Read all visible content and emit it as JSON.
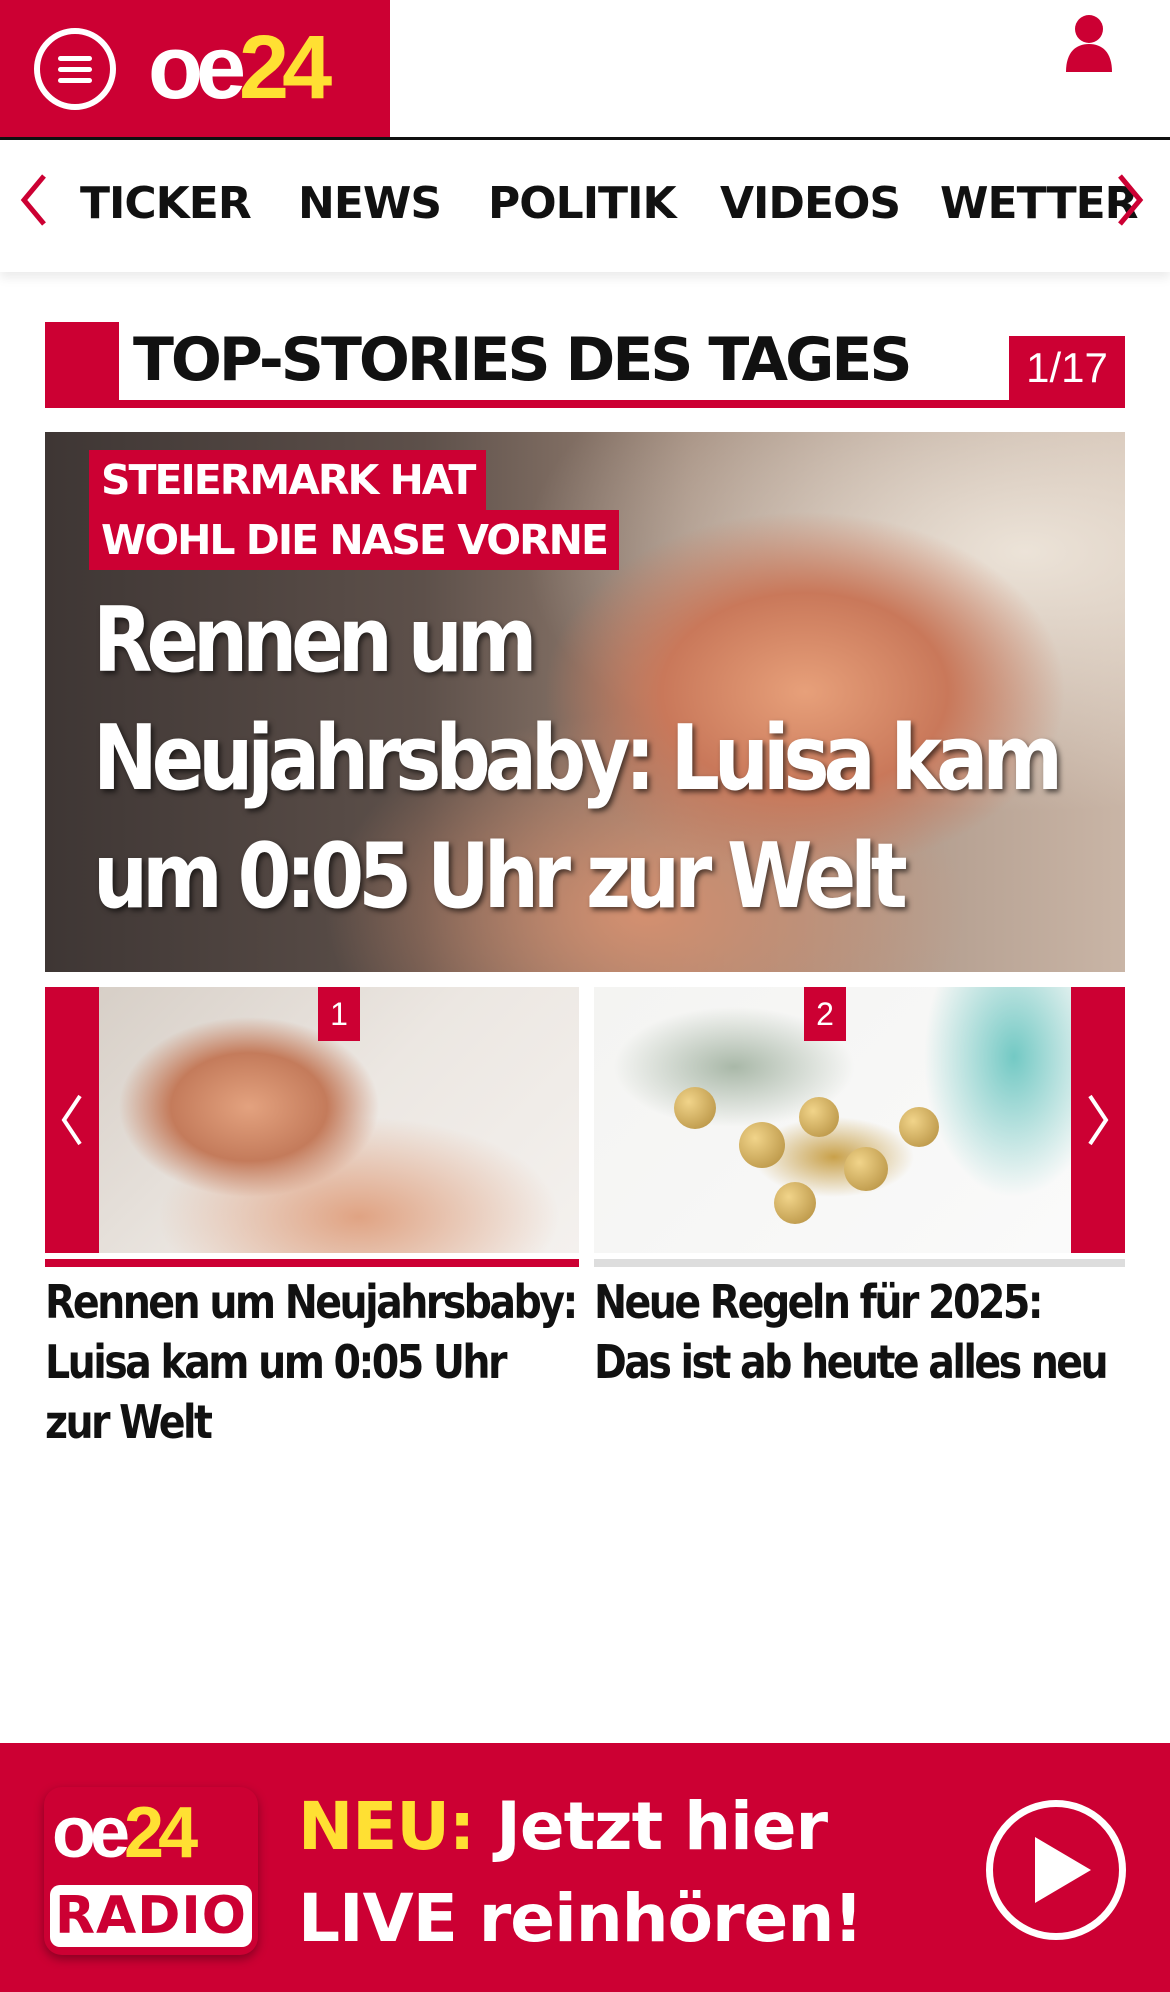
{
  "header": {
    "logo_oe": "oe",
    "logo_num": "24"
  },
  "nav": {
    "items": [
      "TICKER",
      "NEWS",
      "POLITIK",
      "VIDEOS",
      "WETTER"
    ]
  },
  "section": {
    "title": "TOP-STORIES DES TAGES",
    "counter": "1/17"
  },
  "hero": {
    "kicker_line1": "STEIERMARK HAT",
    "kicker_line2": "WOHL DIE NASE VORNE",
    "headline": "Rennen um Neujahrsbaby: Luisa kam um 0:05 Uhr zur Welt"
  },
  "carousel": {
    "items": [
      {
        "num": "1",
        "title": "Rennen um Neujahrsbaby: Luisa kam um 0:05 Uhr zur Welt"
      },
      {
        "num": "2",
        "title": "Neue Regeln für 2025: Das ist ab heute alles neu"
      }
    ]
  },
  "radio": {
    "logo_oe": "oe",
    "logo_num": "24",
    "logo_label": "RADIO",
    "neu": "NEU:",
    "line1_rest": " Jetzt hier",
    "line2": "LIVE reinhören!"
  },
  "colors": {
    "brand_red": "#cc0033",
    "brand_yellow": "#ffe033"
  },
  "icons": [
    "menu-icon",
    "user-icon",
    "chevron-left-icon",
    "chevron-right-icon",
    "play-icon"
  ]
}
